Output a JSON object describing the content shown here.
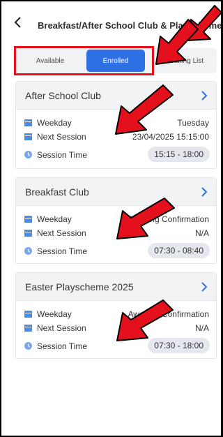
{
  "header": {
    "title": "Breakfast/After School Club & Playscheme"
  },
  "tabs": [
    {
      "label": "Available"
    },
    {
      "label": "Enrolled"
    },
    {
      "label": "Waiting List"
    }
  ],
  "cards": [
    {
      "title": "After School Club",
      "weekday_label": "Weekday",
      "weekday": "Tuesday",
      "next_label": "Next Session",
      "next": "23/04/2025 15:15:00",
      "time_label": "Session Time",
      "time": "15:15 - 18:00"
    },
    {
      "title": "Breakfast Club",
      "weekday_label": "Weekday",
      "weekday": "Awaiting Confirmation",
      "next_label": "Next Session",
      "next": "N/A",
      "time_label": "Session Time",
      "time": "07:30 - 08:40"
    },
    {
      "title": "Easter Playscheme 2025",
      "weekday_label": "Weekday",
      "weekday": "Awaiting Confirmation",
      "next_label": "Next Session",
      "next": "N/A",
      "time_label": "Session Time",
      "time": "07:30 - 18:00"
    }
  ],
  "colors": {
    "accent": "#2f6fe4",
    "annotation_red": "#e4101b"
  },
  "icons": {
    "back": "chevron-left-icon",
    "card_open": "chevron-right-icon",
    "weekday": "calendar-icon",
    "next": "calendar-icon",
    "time": "clock-icon"
  }
}
